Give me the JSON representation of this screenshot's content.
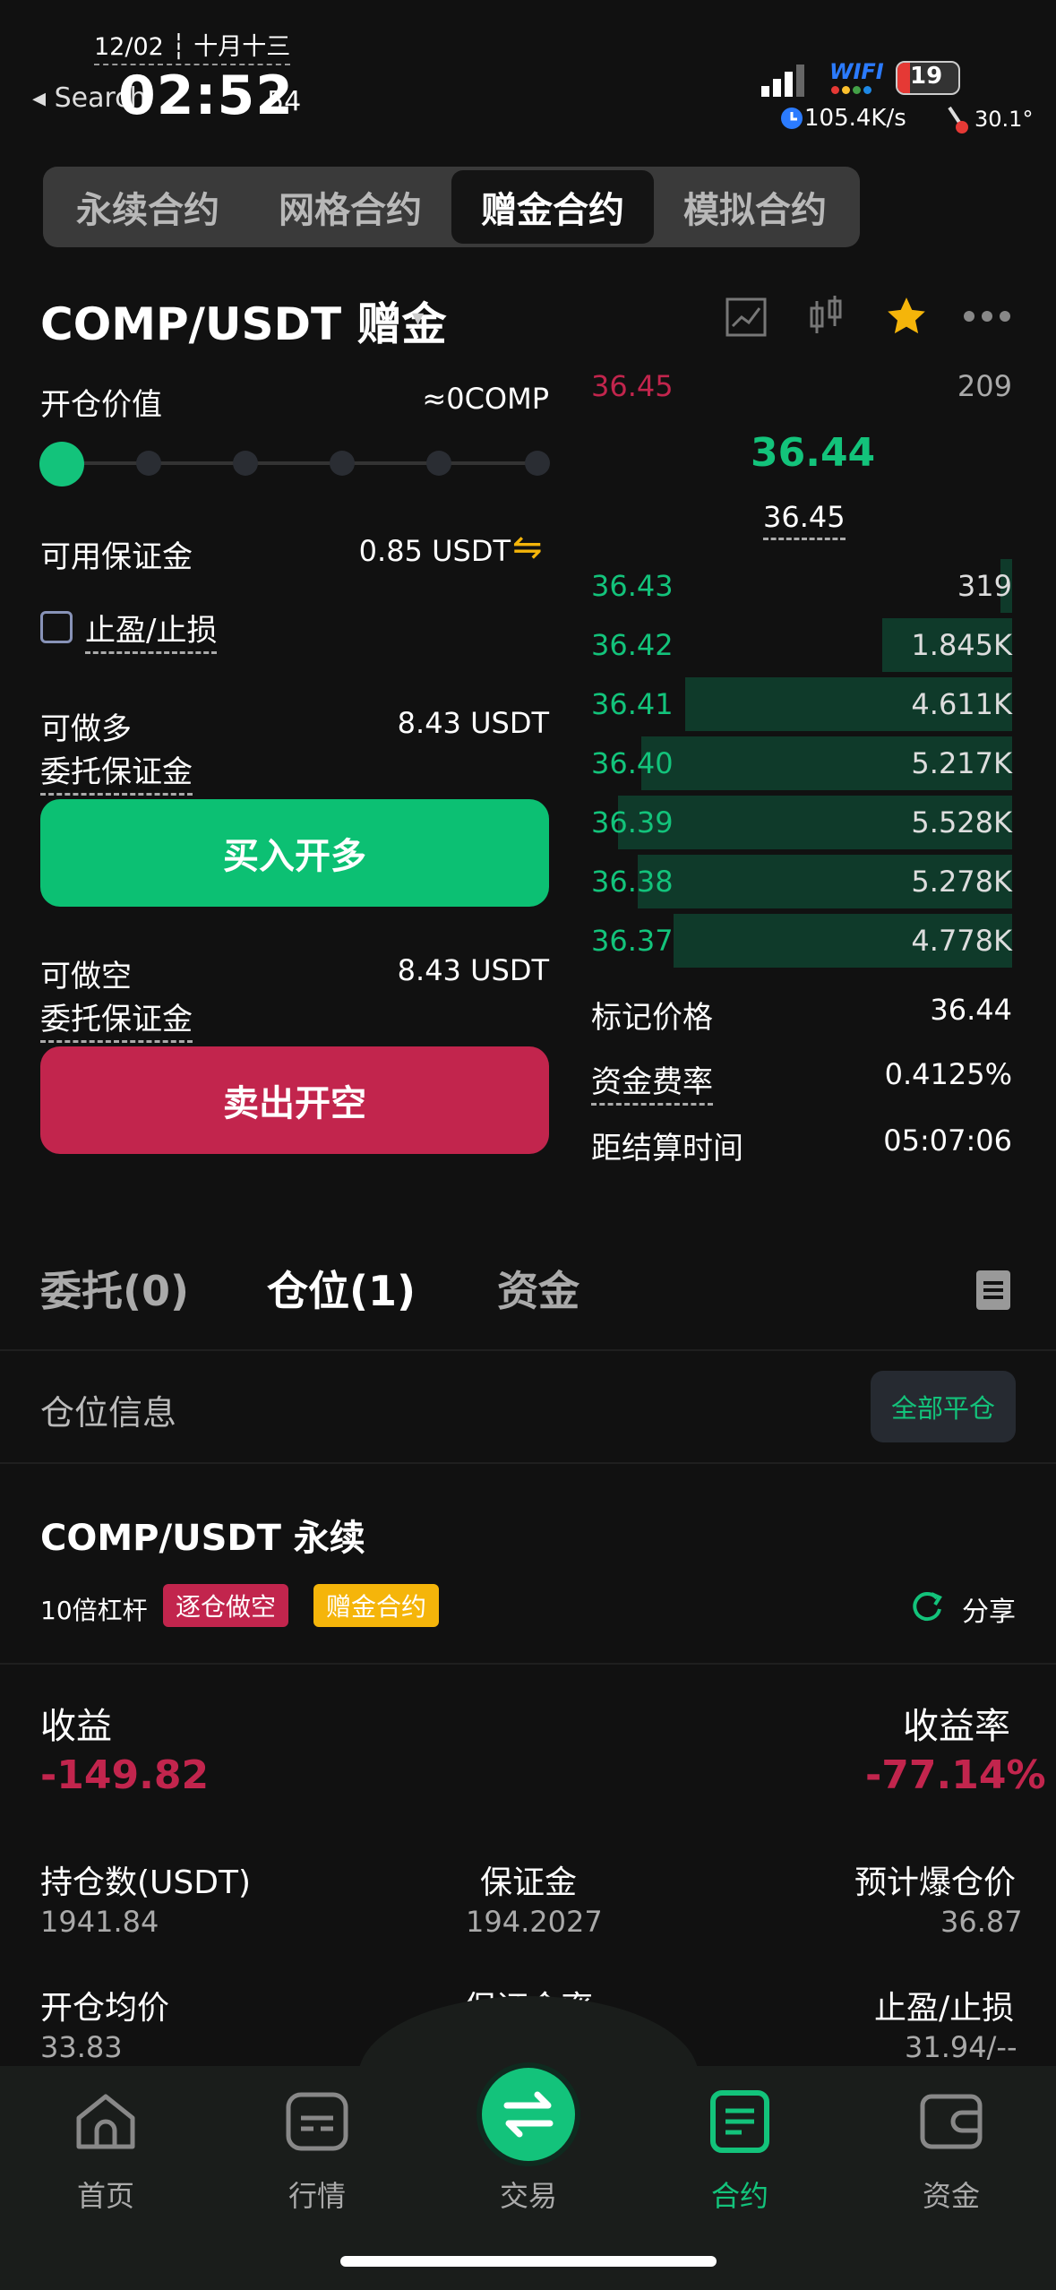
{
  "status": {
    "date": "12/02 ┆ 十月十三",
    "back": "◂ Search",
    "time": "02:52",
    "seconds": "54",
    "wifi": "WIFI",
    "battery": "19",
    "speed": "105.4K/s",
    "temp": "30.1°"
  },
  "contract_tabs": [
    "永续合约",
    "网格合约",
    "赠金合约",
    "模拟合约"
  ],
  "pair": {
    "title": "COMP/USDT 赠金",
    "caret": "▾"
  },
  "form": {
    "open_value_label": "开仓价值",
    "open_value": "≈0COMP",
    "margin_label": "可用保证金",
    "margin_value": "0.85 USDT",
    "swap_icon": "⇋",
    "tpsl_label": "止盈/止损",
    "long_label": "可做多",
    "long_value": "8.43 USDT",
    "long_margin_label": "委托保证金",
    "buy_button": "买入开多",
    "short_label": "可做空",
    "short_value": "8.43 USDT",
    "short_margin_label": "委托保证金",
    "sell_button": "卖出开空"
  },
  "orderbook": {
    "ask_top": {
      "price": "36.45",
      "amount": "209"
    },
    "last_price": "36.44",
    "mark_price_small": "36.45",
    "bids": [
      {
        "price": "36.43",
        "amount": "319",
        "depth": 0.03
      },
      {
        "price": "36.42",
        "amount": "1.845K",
        "depth": 0.33
      },
      {
        "price": "36.41",
        "amount": "4.611K",
        "depth": 0.83
      },
      {
        "price": "36.40",
        "amount": "5.217K",
        "depth": 0.94
      },
      {
        "price": "36.39",
        "amount": "5.528K",
        "depth": 1.0
      },
      {
        "price": "36.38",
        "amount": "5.278K",
        "depth": 0.95
      },
      {
        "price": "36.37",
        "amount": "4.778K",
        "depth": 0.86
      }
    ]
  },
  "info": {
    "mark_label": "标记价格",
    "mark_value": "36.44",
    "funding_label": "资金费率",
    "funding_value": "0.4125%",
    "settle_label": "距结算时间",
    "settle_value": "05:07:06"
  },
  "bottom_tabs": {
    "orders": "委托(0)",
    "positions": "仓位(1)",
    "funds": "资金"
  },
  "position_header": {
    "title": "仓位信息",
    "close_all": "全部平仓"
  },
  "position": {
    "symbol": "COMP/USDT 永续",
    "leverage": "10倍杠杆",
    "tag_mode": "逐仓做空",
    "tag_type": "赠金合约",
    "share": "分享",
    "pnl_label": "收益",
    "pnl_value": "-149.82",
    "roe_label": "收益率",
    "roe_value": "-77.14%",
    "size_label": "持仓数(USDT)",
    "size_value": "1941.84",
    "margin_label": "保证金",
    "margin_value": "194.2027",
    "liq_label": "预计爆仓价",
    "liq_value": "36.87",
    "entry_label": "开仓均价",
    "entry_value": "33.83",
    "margin_ratio_label": "保证金率",
    "tpsl_label": "止盈/止损",
    "tpsl_value": "31.94/--"
  },
  "nav": [
    {
      "label": "首页",
      "icon": "home-icon"
    },
    {
      "label": "行情",
      "icon": "market-icon"
    },
    {
      "label": "交易",
      "icon": "trade-swap-icon"
    },
    {
      "label": "合约",
      "icon": "contract-icon"
    },
    {
      "label": "资金",
      "icon": "wallet-icon"
    }
  ],
  "colors": {
    "green": "#13c37b",
    "red": "#c2254d",
    "yellow": "#f5b50a"
  }
}
